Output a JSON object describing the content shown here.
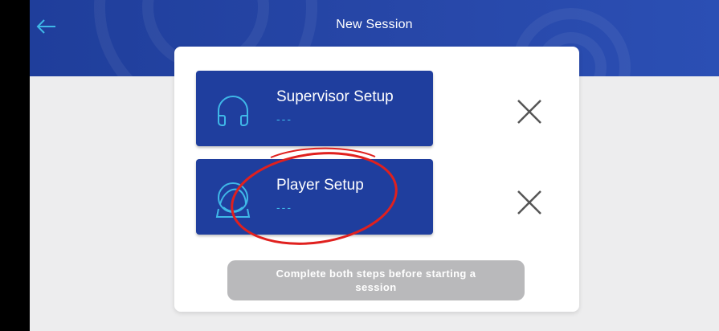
{
  "header": {
    "title": "New Session"
  },
  "steps": [
    {
      "label": "Supervisor Setup",
      "status": "---",
      "icon": "headphones-icon"
    },
    {
      "label": "Player Setup",
      "status": "---",
      "icon": "player-icon"
    }
  ],
  "footer": {
    "button_label": "Complete both steps before starting a session"
  },
  "colors": {
    "header": "#2747a8",
    "step_card": "#1f3e9e",
    "accent": "#3fb8e8",
    "disabled_button": "#b9b9bb",
    "annotation": "#e0201e"
  }
}
